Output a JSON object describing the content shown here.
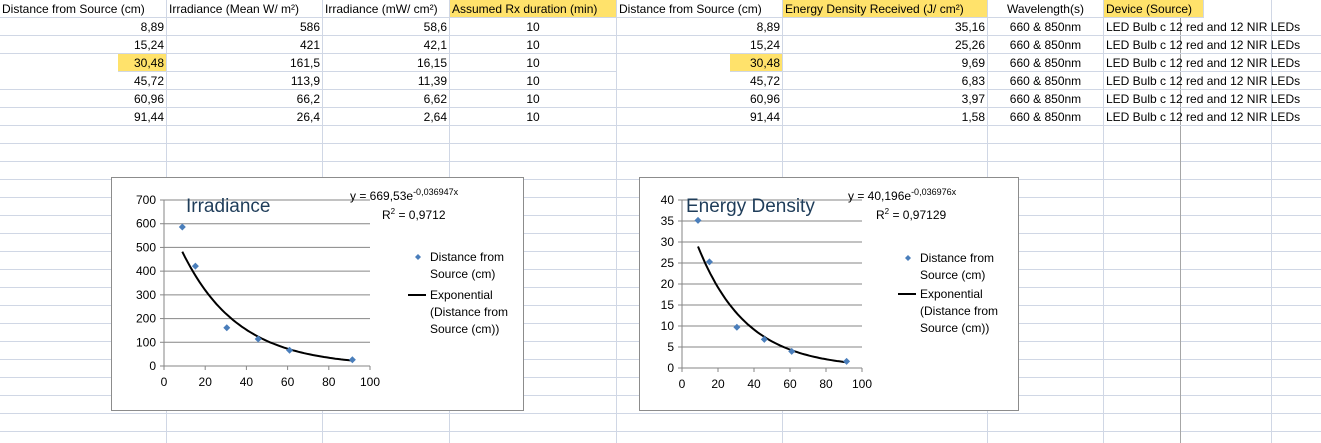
{
  "table_left": {
    "headers": [
      "Distance from Source (cm)",
      "Irradiance (Mean W/ m²)",
      "Irradiance (mW/ cm²)",
      "Assumed Rx duration (min)"
    ],
    "rows": [
      [
        "8,89",
        "586",
        "58,6",
        "10"
      ],
      [
        "15,24",
        "421",
        "42,1",
        "10"
      ],
      [
        "30,48",
        "161,5",
        "16,15",
        "10"
      ],
      [
        "45,72",
        "113,9",
        "11,39",
        "10"
      ],
      [
        "60,96",
        "66,2",
        "6,62",
        "10"
      ],
      [
        "91,44",
        "26,4",
        "2,64",
        "10"
      ]
    ]
  },
  "table_right": {
    "headers": [
      "Distance from Source (cm)",
      "Energy Density Received (J/ cm²)",
      "Wavelength(s)",
      "Device (Source)"
    ],
    "rows": [
      [
        "8,89",
        "35,16",
        "660 & 850nm",
        "LED Bulb c 12 red and 12 NIR LEDs"
      ],
      [
        "15,24",
        "25,26",
        "660 & 850nm",
        "LED Bulb c 12 red and 12 NIR LEDs"
      ],
      [
        "30,48",
        "9,69",
        "660 & 850nm",
        "LED Bulb c 12 red and 12 NIR LEDs"
      ],
      [
        "45,72",
        "6,83",
        "660 & 850nm",
        "LED Bulb c 12 red and 12 NIR LEDs"
      ],
      [
        "60,96",
        "3,97",
        "660 & 850nm",
        "LED Bulb c 12 red and 12 NIR LEDs"
      ],
      [
        "91,44",
        "1,58",
        "660 & 850nm",
        "LED Bulb c 12 red and 12 NIR LEDs"
      ]
    ]
  },
  "highlight_color": "#ffe26b",
  "chart_data": [
    {
      "type": "scatter",
      "title": "Irradiance",
      "x": [
        8.89,
        15.24,
        30.48,
        45.72,
        60.96,
        91.44
      ],
      "y": [
        586,
        421,
        161.5,
        113.9,
        66.2,
        26.4
      ],
      "series_name": "Distance from Source (cm)",
      "trendline": {
        "type": "exponential",
        "a": 669.53,
        "b": -0.036947,
        "name": "Exponential (Distance from Source (cm))",
        "eq_prefix": "y = 669,53e",
        "eq_exp": "-0,036947x",
        "r2_label": "R",
        "r2_value": " = 0,9712"
      },
      "xlim": [
        0,
        100
      ],
      "ylim": [
        0,
        700
      ],
      "xticks": [
        0,
        20,
        40,
        60,
        80,
        100
      ],
      "yticks": [
        0,
        100,
        200,
        300,
        400,
        500,
        600,
        700
      ],
      "legend": [
        "Distance from",
        "Source (cm)"
      ],
      "legend_trend": [
        "Exponential",
        "(Distance from",
        "Source (cm))"
      ],
      "grid": true,
      "legend_position": "right",
      "marker_color": "#4a7ebb"
    },
    {
      "type": "scatter",
      "title": "Energy Density",
      "x": [
        8.89,
        15.24,
        30.48,
        45.72,
        60.96,
        91.44
      ],
      "y": [
        35.16,
        25.26,
        9.69,
        6.83,
        3.97,
        1.58
      ],
      "series_name": "Distance from Source (cm)",
      "trendline": {
        "type": "exponential",
        "a": 40.196,
        "b": -0.036976,
        "name": "Exponential (Distance from Source (cm))",
        "eq_prefix": "y = 40,196e",
        "eq_exp": "-0,036976x",
        "r2_label": "R",
        "r2_value": " = 0,97129"
      },
      "xlim": [
        0,
        100
      ],
      "ylim": [
        0,
        40
      ],
      "xticks": [
        0,
        20,
        40,
        60,
        80,
        100
      ],
      "yticks": [
        0,
        5,
        10,
        15,
        20,
        25,
        30,
        35,
        40
      ],
      "legend": [
        "Distance from",
        "Source (cm)"
      ],
      "legend_trend": [
        "Exponential",
        "(Distance from",
        "Source (cm))"
      ],
      "grid": true,
      "legend_position": "right",
      "marker_color": "#4a7ebb"
    }
  ]
}
